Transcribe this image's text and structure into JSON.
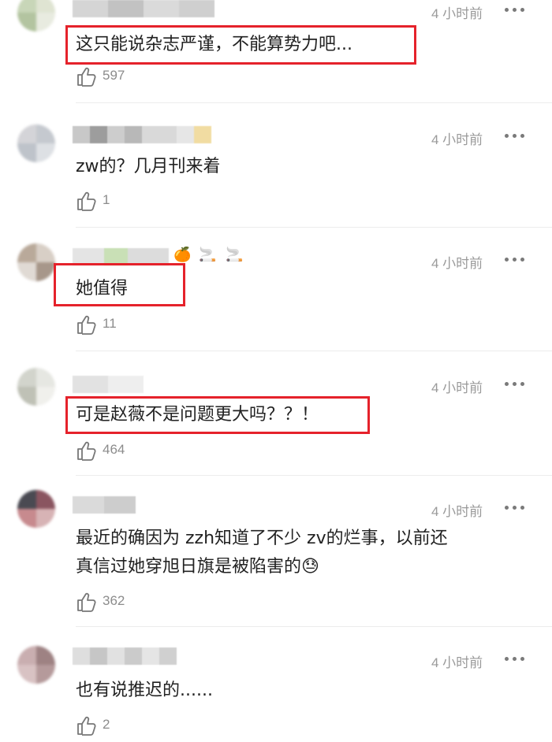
{
  "comments": [
    {
      "time": "4 小时前",
      "text": "这只能说杂志严谨，不能算势力吧...",
      "likes": "597"
    },
    {
      "time": "4 小时前",
      "text": "zw的？几月刊来着",
      "likes": "1"
    },
    {
      "time": "4 小时前",
      "text": "她值得",
      "likes": "11",
      "name_emojis": [
        "🍊",
        "🚬",
        "🚬"
      ]
    },
    {
      "time": "4 小时前",
      "text": "可是赵薇不是问题更大吗？？！",
      "likes": "464"
    },
    {
      "time": "4 小时前",
      "text_line1": "最近的确因为 zzh知道了不少 zv的烂事，以前还",
      "text_line2": "真信过她穿旭日旗是被陷害的",
      "text_emoji": "😓",
      "likes": "362"
    },
    {
      "time": "4 小时前",
      "text": "也有说推迟的......",
      "likes": "2"
    }
  ],
  "icons": {
    "like": "thumbs-up-icon",
    "more": "more-dots-icon"
  },
  "colors": {
    "highlight": "#e5222b",
    "meta": "#9a9a9a",
    "divider": "#ececec"
  }
}
